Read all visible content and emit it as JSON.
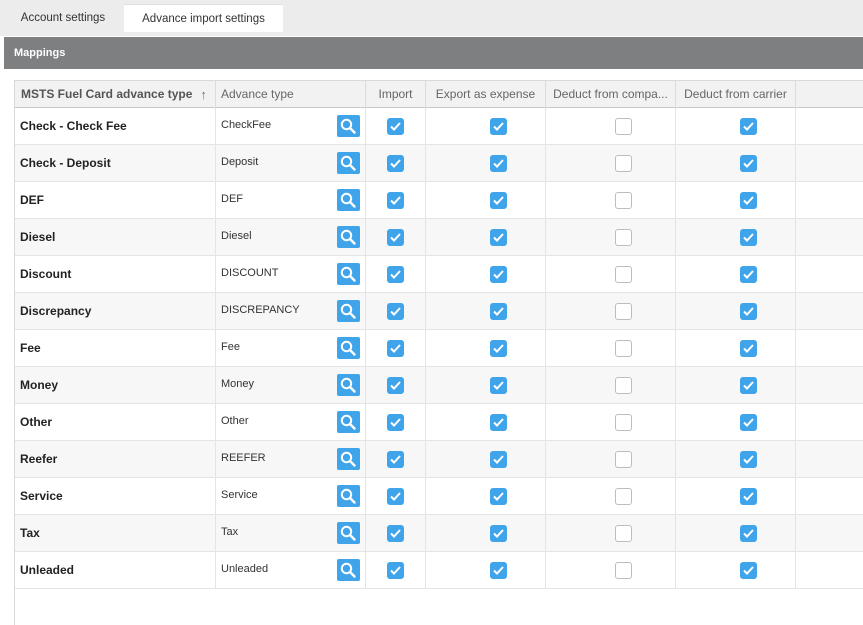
{
  "tabs": [
    {
      "label": "Account settings",
      "active": false
    },
    {
      "label": "Advance import settings",
      "active": true
    }
  ],
  "section": {
    "title": "Mappings"
  },
  "grid": {
    "columns": [
      "MSTS Fuel Card advance type",
      "Advance type",
      "Import",
      "Export as expense",
      "Deduct from compa...",
      "Deduct from carrier"
    ],
    "sort_column": "MSTS Fuel Card advance type",
    "sort_direction": "ascending",
    "rows": [
      {
        "name": "Check - Check Fee",
        "advance_type": "CheckFee",
        "import": true,
        "export_as_expense": true,
        "deduct_from_company": false,
        "deduct_from_carrier": true
      },
      {
        "name": "Check - Deposit",
        "advance_type": "Deposit",
        "import": true,
        "export_as_expense": true,
        "deduct_from_company": false,
        "deduct_from_carrier": true
      },
      {
        "name": "DEF",
        "advance_type": "DEF",
        "import": true,
        "export_as_expense": true,
        "deduct_from_company": false,
        "deduct_from_carrier": true
      },
      {
        "name": "Diesel",
        "advance_type": "Diesel",
        "import": true,
        "export_as_expense": true,
        "deduct_from_company": false,
        "deduct_from_carrier": true
      },
      {
        "name": "Discount",
        "advance_type": "DISCOUNT",
        "import": true,
        "export_as_expense": true,
        "deduct_from_company": false,
        "deduct_from_carrier": true
      },
      {
        "name": "Discrepancy",
        "advance_type": "DISCREPANCY",
        "import": true,
        "export_as_expense": true,
        "deduct_from_company": false,
        "deduct_from_carrier": true
      },
      {
        "name": "Fee",
        "advance_type": "Fee",
        "import": true,
        "export_as_expense": true,
        "deduct_from_company": false,
        "deduct_from_carrier": true
      },
      {
        "name": "Money",
        "advance_type": "Money",
        "import": true,
        "export_as_expense": true,
        "deduct_from_company": false,
        "deduct_from_carrier": true
      },
      {
        "name": "Other",
        "advance_type": "Other",
        "import": true,
        "export_as_expense": true,
        "deduct_from_company": false,
        "deduct_from_carrier": true
      },
      {
        "name": "Reefer",
        "advance_type": "REEFER",
        "import": true,
        "export_as_expense": true,
        "deduct_from_company": false,
        "deduct_from_carrier": true
      },
      {
        "name": "Service",
        "advance_type": "Service",
        "import": true,
        "export_as_expense": true,
        "deduct_from_company": false,
        "deduct_from_carrier": true
      },
      {
        "name": "Tax",
        "advance_type": "Tax",
        "import": true,
        "export_as_expense": true,
        "deduct_from_company": false,
        "deduct_from_carrier": true
      },
      {
        "name": "Unleaded",
        "advance_type": "Unleaded",
        "import": true,
        "export_as_expense": true,
        "deduct_from_company": false,
        "deduct_from_carrier": true
      }
    ]
  },
  "colors": {
    "accent": "#3fa4ea",
    "section_bar": "#7d7f81",
    "tabbar": "#ececec"
  },
  "icons": {
    "lookup": "search-icon",
    "sort": "sort-arrow-up-icon",
    "checked": "checkmark-icon"
  }
}
